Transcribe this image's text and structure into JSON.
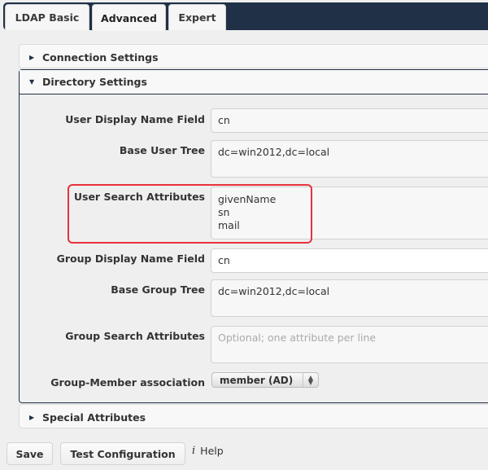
{
  "tabs": [
    {
      "label": "LDAP Basic",
      "active": false
    },
    {
      "label": "Advanced",
      "active": true
    },
    {
      "label": "Expert",
      "active": false
    }
  ],
  "sections": {
    "connection": {
      "title": "Connection Settings",
      "expanded": false
    },
    "directory": {
      "title": "Directory Settings",
      "expanded": true
    },
    "special": {
      "title": "Special Attributes",
      "expanded": false
    }
  },
  "directory_fields": {
    "user_display_name": {
      "label": "User Display Name Field",
      "value": "cn"
    },
    "base_user_tree": {
      "label": "Base User Tree",
      "value": "dc=win2012,dc=local"
    },
    "user_search_attributes": {
      "label": "User Search Attributes",
      "value": "givenName\nsn\nmail"
    },
    "group_display_name": {
      "label": "Group Display Name Field",
      "value": "cn"
    },
    "base_group_tree": {
      "label": "Base Group Tree",
      "value": "dc=win2012,dc=local"
    },
    "group_search_attributes": {
      "label": "Group Search Attributes",
      "value": "",
      "placeholder": "Optional; one attribute per line"
    },
    "group_member_association": {
      "label": "Group-Member association",
      "selected": "member (AD)"
    }
  },
  "icons": {
    "caret_right": "▶",
    "caret_down": "▼",
    "select_up": "▲",
    "select_down": "▼",
    "info": "i"
  },
  "footer": {
    "save_label": "Save",
    "test_label": "Test Configuration",
    "help_label": "Help"
  },
  "colors": {
    "tabbar": "#1f3047",
    "highlight": "#e8323c"
  }
}
